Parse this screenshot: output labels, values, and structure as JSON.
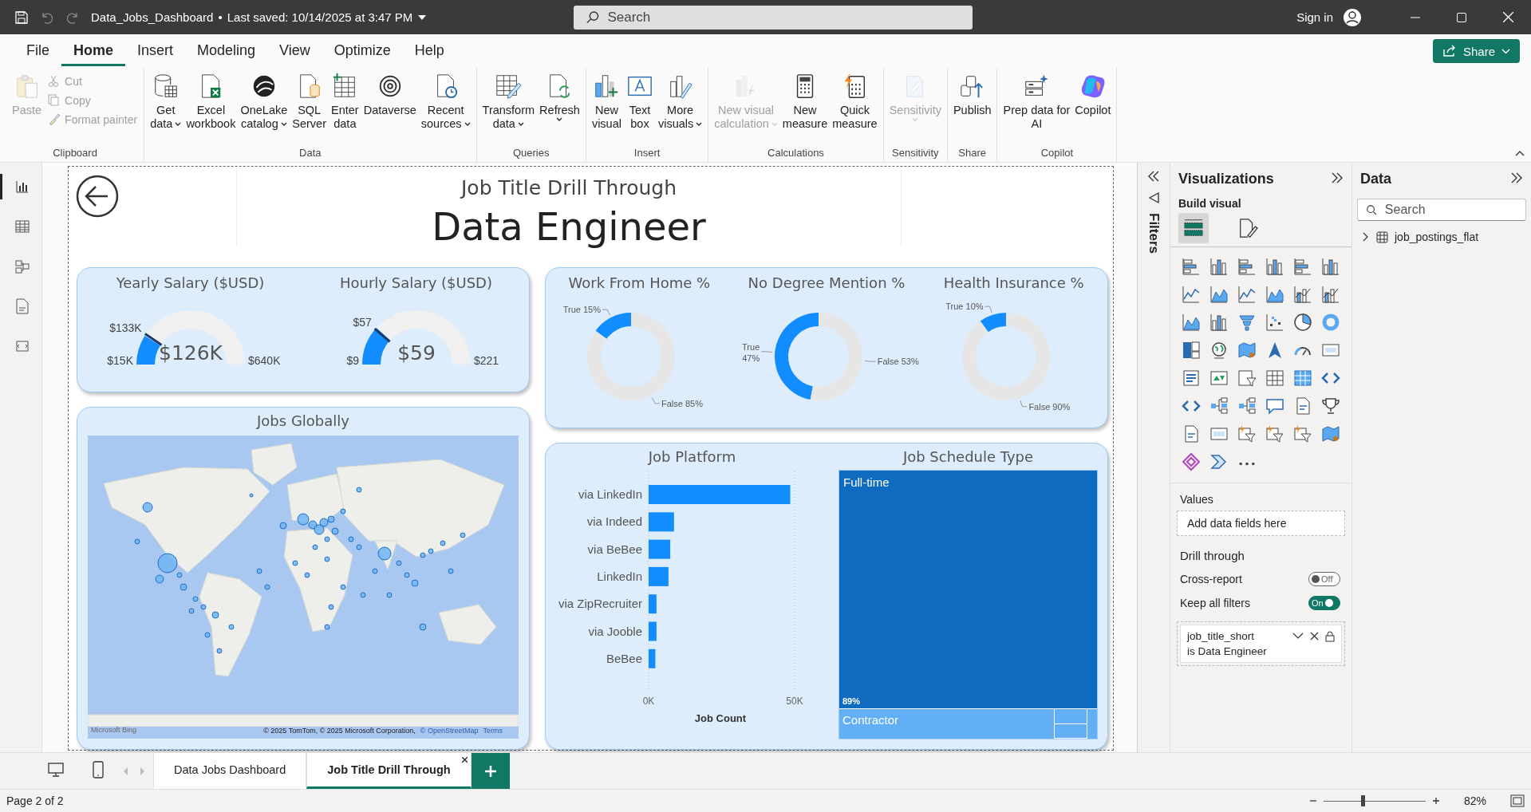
{
  "title_bar": {
    "file_name": "Data_Jobs_Dashboard",
    "separator": "•",
    "saved": "Last saved: 10/14/2025 at 3:47 PM",
    "search": {
      "placeholder": "Search"
    },
    "sign_in": "Sign in"
  },
  "menu": [
    {
      "label": "File",
      "selected": false
    },
    {
      "label": "Home",
      "selected": true
    },
    {
      "label": "Insert",
      "selected": false
    },
    {
      "label": "Modeling",
      "selected": false
    },
    {
      "label": "View",
      "selected": false
    },
    {
      "label": "Optimize",
      "selected": false
    },
    {
      "label": "Help",
      "selected": false
    }
  ],
  "share": "Share",
  "ribbon": [
    {
      "label": "Clipboard",
      "buttons": [
        {
          "kind": "paste",
          "lines": [
            "Paste"
          ],
          "disabled": true,
          "dropdown": false
        }
      ],
      "small_buttons": [
        {
          "kind": "cut",
          "label": "Cut",
          "disabled": true
        },
        {
          "kind": "copy",
          "label": "Copy",
          "disabled": true
        },
        {
          "kind": "format-painter",
          "label": "Format painter",
          "disabled": true
        }
      ]
    },
    {
      "label": "Data",
      "buttons": [
        {
          "kind": "get-data",
          "lines": [
            "Get",
            "data"
          ],
          "disabled": false,
          "dropdown": true
        },
        {
          "kind": "excel",
          "lines": [
            "Excel",
            "workbook"
          ],
          "disabled": false,
          "dropdown": false
        },
        {
          "kind": "onelake",
          "lines": [
            "OneLake",
            "catalog"
          ],
          "disabled": false,
          "dropdown": true
        },
        {
          "kind": "sql",
          "lines": [
            "SQL",
            "Server"
          ],
          "disabled": false,
          "dropdown": false
        },
        {
          "kind": "enter-data",
          "lines": [
            "Enter",
            "data"
          ],
          "disabled": false,
          "dropdown": false
        },
        {
          "kind": "dataverse",
          "lines": [
            "Dataverse"
          ],
          "disabled": false,
          "dropdown": false
        },
        {
          "kind": "recent",
          "lines": [
            "Recent",
            "sources"
          ],
          "disabled": false,
          "dropdown": true
        }
      ]
    },
    {
      "label": "Queries",
      "buttons": [
        {
          "kind": "transform",
          "lines": [
            "Transform",
            "data"
          ],
          "disabled": false,
          "dropdown": true
        },
        {
          "kind": "refresh",
          "lines": [
            "Refresh"
          ],
          "disabled": false,
          "dropdown": true
        }
      ]
    },
    {
      "label": "Insert",
      "buttons": [
        {
          "kind": "new-visual",
          "lines": [
            "New",
            "visual"
          ],
          "disabled": false,
          "dropdown": false
        },
        {
          "kind": "text-box",
          "lines": [
            "Text",
            "box"
          ],
          "disabled": false,
          "dropdown": false
        },
        {
          "kind": "more-visuals",
          "lines": [
            "More",
            "visuals"
          ],
          "disabled": false,
          "dropdown": true
        }
      ]
    },
    {
      "label": "Calculations",
      "buttons": [
        {
          "kind": "visual-calc",
          "lines": [
            "New visual",
            "calculation"
          ],
          "disabled": true,
          "dropdown": true
        },
        {
          "kind": "new-measure",
          "lines": [
            "New",
            "measure"
          ],
          "disabled": false,
          "dropdown": false
        },
        {
          "kind": "quick-measure",
          "lines": [
            "Quick",
            "measure"
          ],
          "disabled": false,
          "dropdown": false
        }
      ]
    },
    {
      "label": "Sensitivity",
      "buttons": [
        {
          "kind": "sensitivity",
          "lines": [
            "Sensitivity"
          ],
          "disabled": true,
          "dropdown": true
        }
      ]
    },
    {
      "label": "Share",
      "buttons": [
        {
          "kind": "publish",
          "lines": [
            "Publish"
          ],
          "disabled": false,
          "dropdown": false
        }
      ]
    },
    {
      "label": "Copilot",
      "buttons": [
        {
          "kind": "prep-ai",
          "lines": [
            "Prep data for",
            "AI"
          ],
          "disabled": false,
          "dropdown": false
        },
        {
          "kind": "copilot",
          "lines": [
            "Copilot"
          ],
          "disabled": false,
          "dropdown": false
        }
      ]
    }
  ],
  "views": [
    {
      "kind": "report",
      "selected": true
    },
    {
      "kind": "table",
      "selected": false
    },
    {
      "kind": "model",
      "selected": false
    },
    {
      "kind": "dax",
      "selected": false
    },
    {
      "kind": "tmdl",
      "selected": false
    }
  ],
  "page_header": {
    "subtitle": "Job Title Drill Through",
    "title": "Data Engineer"
  },
  "gauges": [
    {
      "title": "Yearly Salary ($USD)",
      "min": "$15K",
      "max": "$640K",
      "value": "$126K",
      "level": 0.178,
      "target": {
        "label": "$133K",
        "level": 0.189
      }
    },
    {
      "title": "Hourly Salary ($USD)",
      "min": "$9",
      "max": "$221",
      "value": "$59",
      "level": 0.236,
      "target": {
        "label": "$57",
        "level": 0.226
      }
    }
  ],
  "donuts": [
    {
      "chart_data": {
        "type": "donut",
        "title": "Work From Home %",
        "categories": [
          "True",
          "False"
        ],
        "values": [
          15,
          85
        ],
        "value_labels": [
          "15%",
          "85%"
        ]
      }
    },
    {
      "chart_data": {
        "type": "donut",
        "title": "No Degree Mention %",
        "categories": [
          "True",
          "False"
        ],
        "values": [
          47,
          53
        ],
        "value_labels": [
          "47%",
          "53%"
        ]
      }
    },
    {
      "chart_data": {
        "type": "donut",
        "title": "Health Insurance %",
        "categories": [
          "True",
          "False"
        ],
        "values": [
          10,
          90
        ],
        "value_labels": [
          "10%",
          "90%"
        ]
      }
    }
  ],
  "map_card": {
    "title": "Jobs Globally",
    "logo": "Microsoft Bing",
    "attribution": "© 2025 TomTom, © 2025 Microsoft Corporation,",
    "links": [
      "© OpenStreetMap",
      "Terms"
    ]
  },
  "platform_chart": {
    "chart_data": {
      "type": "bar",
      "orientation": "horizontal",
      "title": "Job Platform",
      "xlabel": "Job Count",
      "categories": [
        "via LinkedIn",
        "via Indeed",
        "via BeBee",
        "LinkedIn",
        "via ZipRecruiter",
        "via Jooble",
        "BeBee"
      ],
      "series": [
        {
          "color": "#118dff",
          "values": [
            48500,
            8700,
            7400,
            6800,
            2700,
            2700,
            2300
          ]
        }
      ],
      "xlim": [
        0,
        50000
      ],
      "xticks": [
        {
          "value": 0,
          "label": "0K"
        },
        {
          "value": 50000,
          "label": "50K"
        }
      ]
    }
  },
  "schedule_treemap": {
    "title": "Job Schedule Type",
    "items": [
      {
        "label": "Full-time",
        "share_label": "89%",
        "level": 0.89
      },
      {
        "label": "Contractor"
      }
    ]
  },
  "filters_pane": {
    "label": "Filters"
  },
  "visualizations": {
    "title": "Visualizations",
    "build_label": "Build visual",
    "build_tabs": [
      {
        "selected": true
      },
      {
        "selected": false
      }
    ],
    "values_label": "Values",
    "values_placeholder": "Add data fields here",
    "drill_title": "Drill through",
    "toggles": [
      {
        "label": "Cross-report",
        "on": false,
        "state_label": "Off"
      },
      {
        "label": "Keep all filters",
        "on": true,
        "state_label": "On"
      }
    ],
    "filter_card": {
      "field": "job_title_short",
      "condition": "is Data Engineer"
    }
  },
  "data_pane": {
    "title": "Data",
    "search": {
      "placeholder": "Search"
    },
    "tables": [
      {
        "label": "job_postings_flat",
        "expanded": false
      }
    ]
  },
  "page_tabs": [
    {
      "label": "Data Jobs Dashboard",
      "selected": false
    },
    {
      "label": "Job Title Drill Through",
      "selected": true
    }
  ],
  "status_bar": {
    "page": "Page 2 of 2",
    "zoom": {
      "level": 0.38
    },
    "zoom_label": "82%"
  }
}
